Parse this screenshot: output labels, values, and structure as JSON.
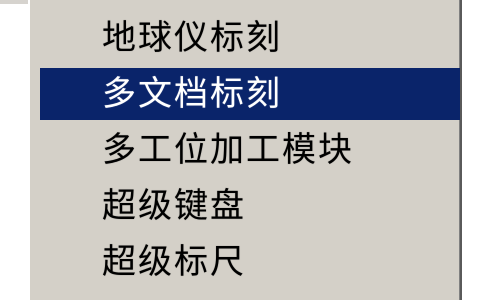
{
  "menu": {
    "items": [
      {
        "label": "地球仪标刻"
      },
      {
        "label": "多文档标刻"
      },
      {
        "label": "多工位加工模块"
      },
      {
        "label": "超级键盘"
      },
      {
        "label": "超级标尺"
      }
    ],
    "selected_index": 1,
    "colors": {
      "menu_background": "#d4d0c8",
      "highlight": "#0a246a",
      "highlight_text": "#ffffff",
      "text": "#000000"
    }
  }
}
